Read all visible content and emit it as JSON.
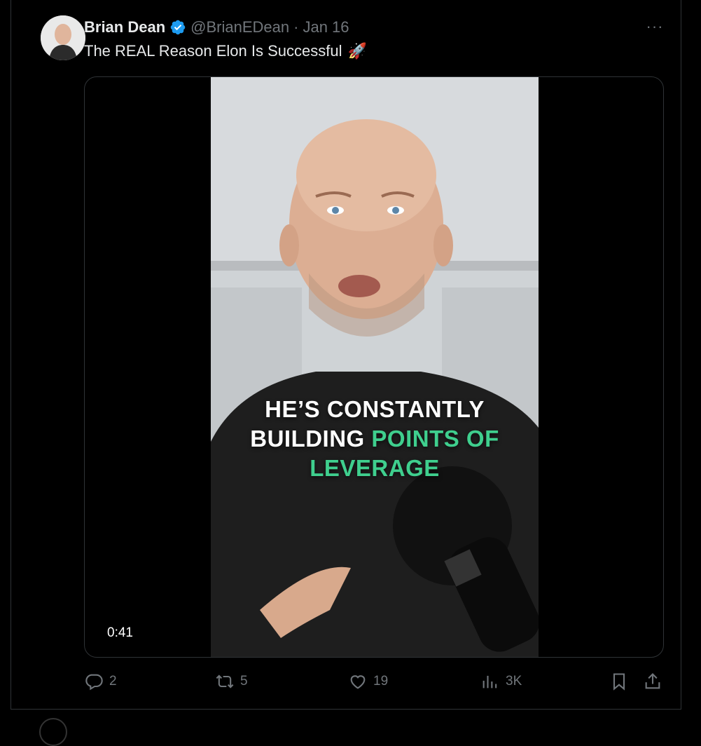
{
  "tweet": {
    "author_name": "Brian Dean",
    "handle": "@BrianEDean",
    "separator": "·",
    "date": "Jan 16",
    "more_label": "···",
    "text": "The REAL Reason Elon Is Successful",
    "emoji": "🚀"
  },
  "video": {
    "caption_line1": "HE’S CONSTANTLY",
    "caption_line2_white": "BUILDING ",
    "caption_line2_green": "POINTS OF",
    "caption_line3_green": "LEVERAGE",
    "duration": "0:41"
  },
  "actions": {
    "replies": "2",
    "reposts": "5",
    "likes": "19",
    "views": "3K"
  },
  "colors": {
    "background": "#000000",
    "text": "#e7e9ea",
    "muted": "#71767b",
    "verified": "#1d9bf0",
    "caption_highlight": "#3fcf8e"
  }
}
